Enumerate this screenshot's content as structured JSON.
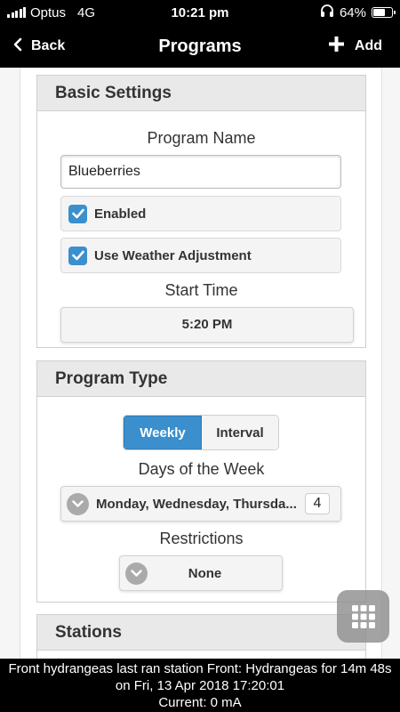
{
  "status_bar": {
    "carrier": "Optus",
    "network": "4G",
    "time": "10:21 pm",
    "battery_text": "64%",
    "battery_level": 0.64
  },
  "header": {
    "back_label": "Back",
    "title": "Programs",
    "add_label": "Add"
  },
  "basic_settings": {
    "heading": "Basic Settings",
    "program_name_label": "Program Name",
    "program_name_value": "Blueberries",
    "enabled_label": "Enabled",
    "enabled_checked": true,
    "weather_label": "Use Weather Adjustment",
    "weather_checked": true,
    "start_time_label": "Start Time",
    "start_time_value": "5:20 PM"
  },
  "program_type": {
    "heading": "Program Type",
    "options": [
      "Weekly",
      "Interval"
    ],
    "selected": "Weekly",
    "days_label": "Days of the Week",
    "days_value": "Monday, Wednesday, Thursda...",
    "days_count": "4",
    "restrictions_label": "Restrictions",
    "restrictions_value": "None"
  },
  "stations": {
    "heading": "Stations"
  },
  "footer": {
    "line1": "Front hydrangeas last ran station Front: Hydrangeas for 14m 48s",
    "line2": "on Fri, 13 Apr 2018 17:20:01",
    "line3": "Current: 0 mA"
  },
  "colors": {
    "accent": "#3b8fcd",
    "bar_background": "#000000",
    "card_header": "#e9e9e9"
  },
  "icons": [
    "signal-icon",
    "headphones-icon",
    "battery-icon",
    "back-chevron-icon",
    "plus-icon",
    "checkmark-icon",
    "chevron-down-icon",
    "grid-icon"
  ]
}
